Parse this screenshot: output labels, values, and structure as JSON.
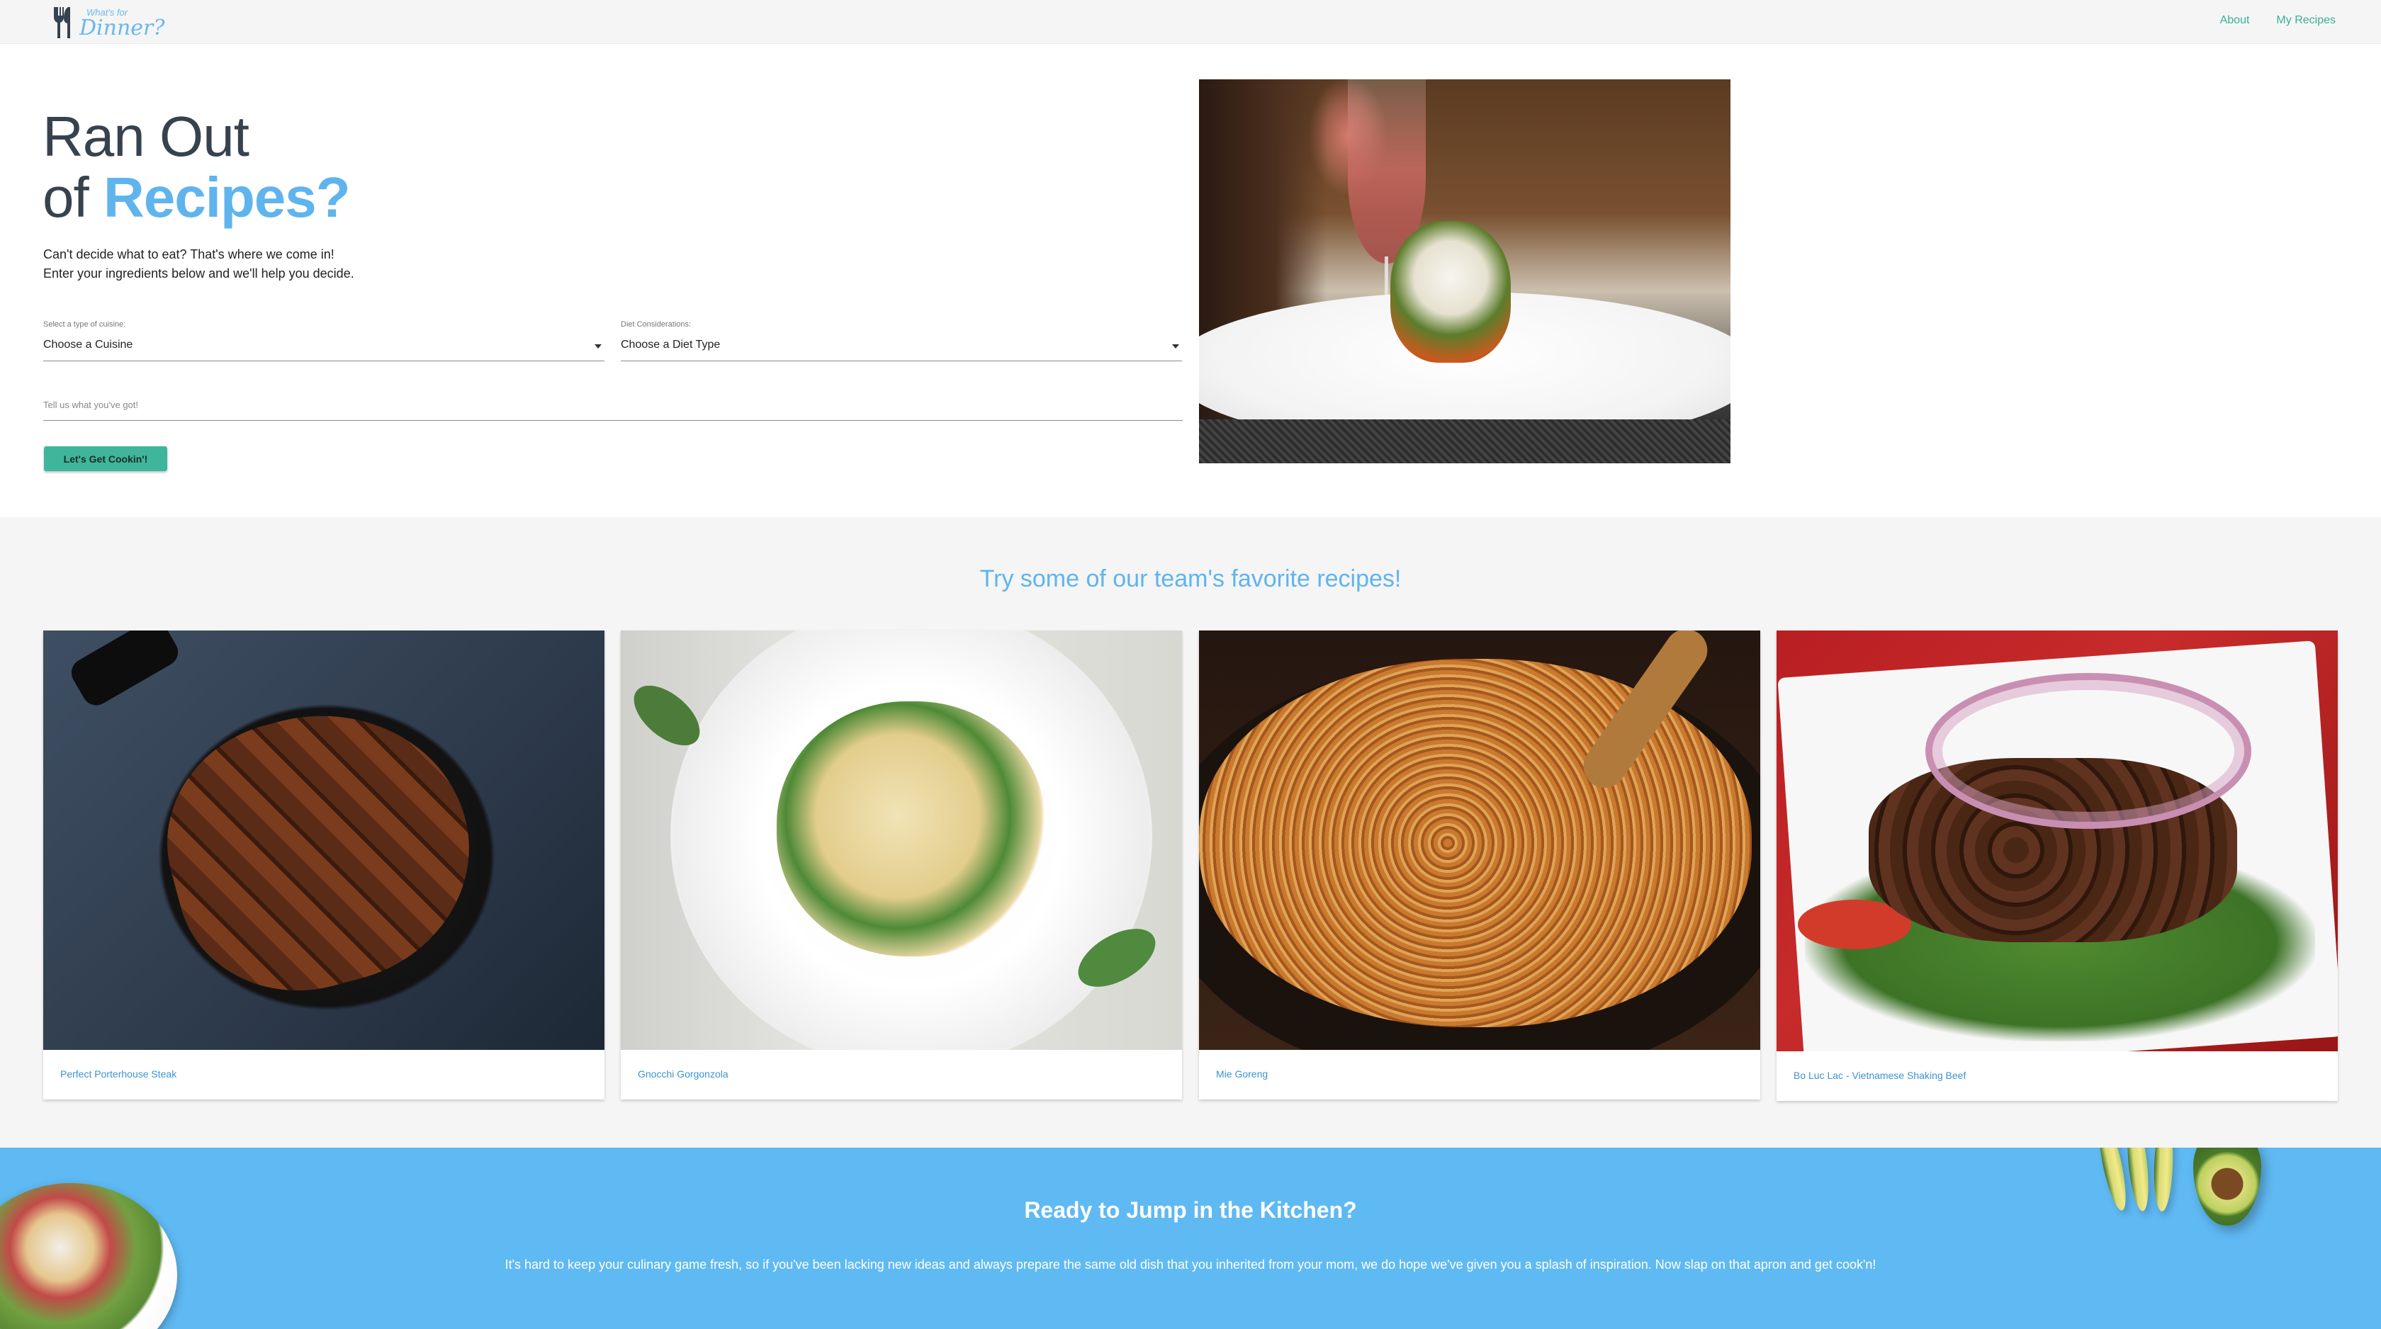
{
  "nav": {
    "logo_small": "What's for",
    "logo_main": "Dinner?",
    "links": [
      "About",
      "My Recipes"
    ]
  },
  "hero": {
    "title_line1": "Ran Out",
    "title_line2_prefix": "of ",
    "title_line2_accent": "Recipes?",
    "desc_line1": "Can't decide what to eat? That's where we come in!",
    "desc_line2": "Enter your ingredients below and we'll help you decide.",
    "cuisine_label": "Select a type of cuisine:",
    "cuisine_value": "Choose a Cuisine",
    "diet_label": "Diet Considerations:",
    "diet_value": "Choose a Diet Type",
    "ingredients_placeholder": "Tell us what you've got!",
    "button_label": "Let's Get Cookin'!"
  },
  "favorites": {
    "title": "Try some of our team's favorite recipes!",
    "recipes": [
      {
        "name": "Perfect Porterhouse Steak"
      },
      {
        "name": "Gnocchi Gorgonzola"
      },
      {
        "name": "Mie Goreng"
      },
      {
        "name": "Bo Luc Lac - Vietnamese Shaking Beef"
      }
    ]
  },
  "cta": {
    "title": "Ready to Jump in the Kitchen?",
    "text": "It's hard to keep your culinary game fresh, so if you've been lacking new ideas and always prepare the same old dish that you inherited from your mom, we do hope we've given you a splash of inspiration. Now slap on that apron and get cook'n!"
  },
  "colors": {
    "accent_blue": "#5fb4ee",
    "button_green": "#3fb59c",
    "nav_link": "#3aaf9a",
    "cta_bg": "#5fb9f3"
  }
}
